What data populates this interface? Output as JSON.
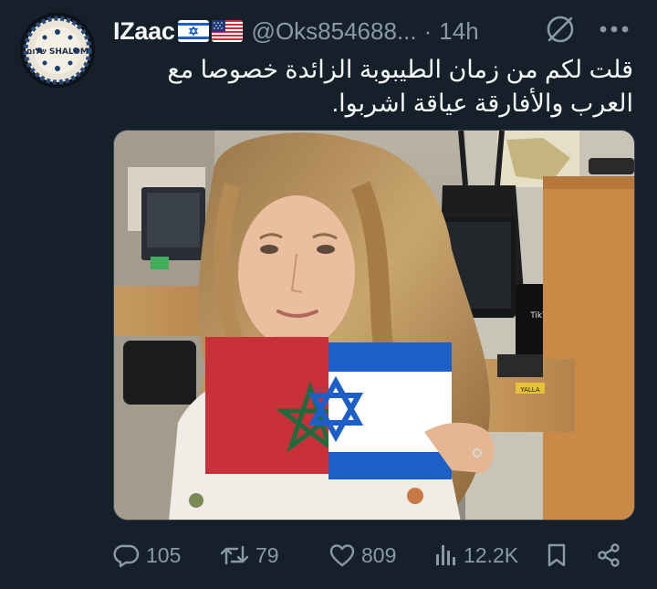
{
  "author": {
    "display_name": "IZaac",
    "handle": "@Oks854688...",
    "separator": "·",
    "time": "14h",
    "flags": [
      "israel-flag",
      "usa-flag"
    ],
    "avatar_caption": "שלום SHALOM"
  },
  "tweet": {
    "text_lines": [
      "قلت لكم من زمان الطيبوبة الزائدة خصوصا مع",
      "العرب والأفارقة عياقة اشربوا."
    ]
  },
  "media": {
    "subject": "photo",
    "tiktok_label": "TikTok",
    "sticker_label": "YALLA"
  },
  "actions": {
    "replies": "105",
    "reposts": "79",
    "likes": "809",
    "views": "12.2K"
  },
  "colors": {
    "background": "#15202b",
    "text_primary": "#f7f9f9",
    "text_secondary": "#8b98a5",
    "border": "#38444d",
    "flag_blue": "#1b5fc7",
    "morocco_red": "#c8313a",
    "morocco_green": "#1f6b3b"
  },
  "icons": [
    "mute-icon",
    "more-icon",
    "reply-icon",
    "repost-icon",
    "like-icon",
    "views-icon",
    "bookmark-icon",
    "share-icon"
  ]
}
